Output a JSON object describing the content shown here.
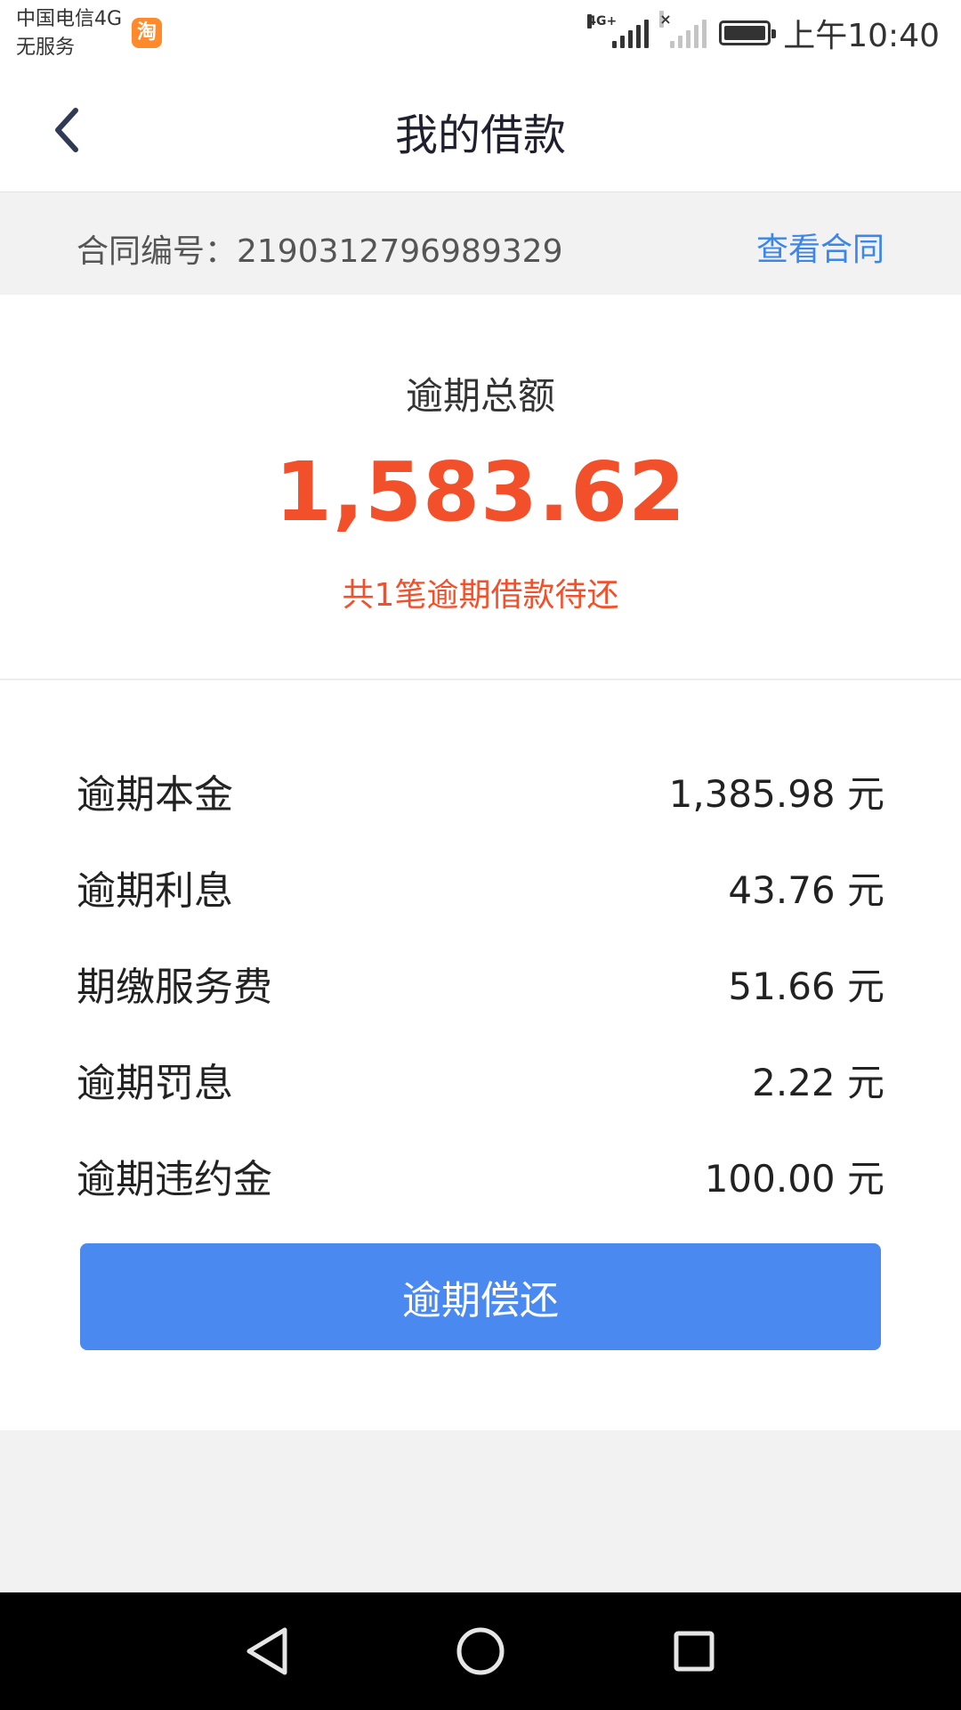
{
  "status_bar": {
    "carrier_line1": "中国电信4G",
    "carrier_line2": "无服务",
    "app_badge": "淘",
    "network_tag": "4G+",
    "time": "上午10:40"
  },
  "header": {
    "title": "我的借款"
  },
  "contract": {
    "label": "合同编号：2190312796989329",
    "link": "查看合同"
  },
  "summary": {
    "label": "逾期总额",
    "amount": "1,583.62",
    "note": "共1笔逾期借款待还"
  },
  "details": [
    {
      "label": "逾期本金",
      "value": "1,385.98 元"
    },
    {
      "label": "逾期利息",
      "value": "43.76 元"
    },
    {
      "label": "期缴服务费",
      "value": "51.66 元"
    },
    {
      "label": "逾期罚息",
      "value": "2.22 元"
    },
    {
      "label": "逾期违约金",
      "value": "100.00 元"
    }
  ],
  "actions": {
    "repay": "逾期偿还"
  },
  "colors": {
    "accent_blue": "#4a8af0",
    "link_blue": "#3b86e8",
    "alert_red": "#f2502b"
  },
  "icons": {
    "back": "chevron-left-icon",
    "sys_back": "triangle-back-icon",
    "sys_home": "circle-home-icon",
    "sys_recent": "square-recent-icon"
  }
}
